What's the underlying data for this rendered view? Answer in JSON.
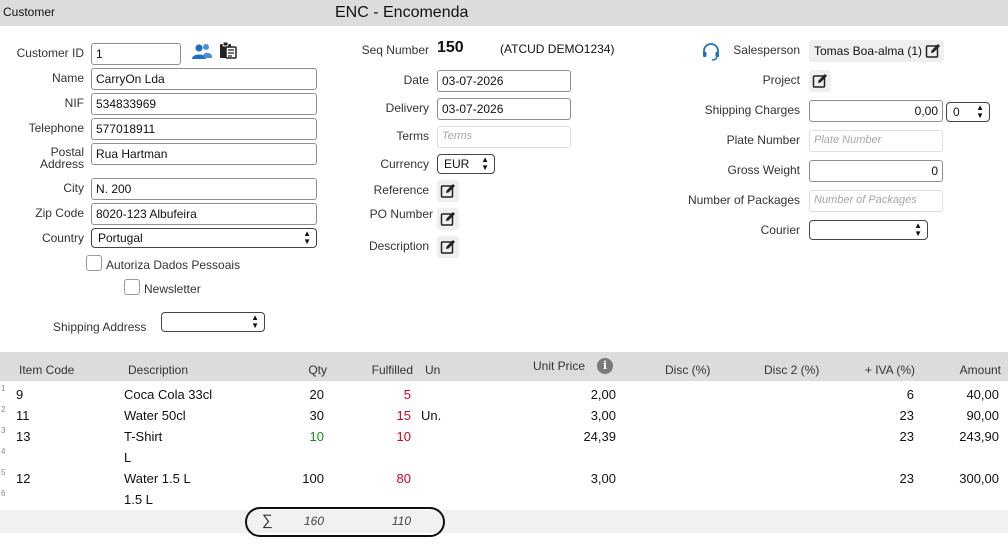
{
  "header": {
    "section_label": "Customer",
    "doc_title": "ENC - Encomenda"
  },
  "customer": {
    "customer_id_label": "Customer ID",
    "customer_id": "1",
    "name_label": "Name",
    "name": "CarryOn Lda",
    "nif_label": "NIF",
    "nif": "534833969",
    "telephone_label": "Telephone",
    "telephone": "577018911",
    "postal_label_1": "Postal",
    "postal_label_2": "Address",
    "postal": "Rua Hartman",
    "city_label": "City",
    "city": "N. 200",
    "zip_label": "Zip Code",
    "zip": "8020-123 Albufeira",
    "country_label": "Country",
    "country": "Portugal",
    "autoriza_label": "Autoriza Dados Pessoais",
    "newsletter_label": "Newsletter",
    "shipping_address_label": "Shipping Address",
    "shipping_address": ""
  },
  "document": {
    "seq_label": "Seq Number",
    "seq": "150",
    "atcud": "(ATCUD DEMO1234)",
    "date_label": "Date",
    "date": "03-07-2026",
    "delivery_label": "Delivery",
    "delivery": "03-07-2026",
    "terms_label": "Terms",
    "terms_placeholder": "Terms",
    "currency_label": "Currency",
    "currency": "EUR",
    "reference_label": "Reference",
    "po_label": "PO Number",
    "description_label": "Description"
  },
  "shipping": {
    "salesperson_label": "Salesperson",
    "salesperson": "Tomas Boa-alma (1)",
    "project_label": "Project",
    "shipping_charges_label": "Shipping Charges",
    "shipping_charges": "0,00",
    "shipping_charges_option": "0",
    "plate_label": "Plate Number",
    "plate_placeholder": "Plate Number",
    "gross_weight_label": "Gross Weight",
    "gross_weight": "0",
    "packages_label": "Number of Packages",
    "packages_placeholder": "Number of Packages",
    "courier_label": "Courier",
    "courier": ""
  },
  "table": {
    "columns": {
      "item_code": "Item Code",
      "description": "Description",
      "qty": "Qty",
      "fulfilled": "Fulfilled",
      "un": "Un",
      "unit_price": "Unit Price",
      "disc": "Disc (%)",
      "disc2": "Disc 2 (%)",
      "iva": "+ IVA (%)",
      "amount": "Amount"
    },
    "rows": [
      {
        "n": "1",
        "code": "9",
        "desc": "Coca Cola 33cl",
        "qty": "20",
        "fulfilled": "5",
        "un": "",
        "price": "2,00",
        "iva": "6",
        "amount": "40,00"
      },
      {
        "n": "2",
        "code": "11",
        "desc": "Water 50cl",
        "qty": "30",
        "fulfilled": "15",
        "un": "Un.",
        "price": "3,00",
        "iva": "23",
        "amount": "90,00"
      },
      {
        "n": "3",
        "code": "13",
        "desc": "T-Shirt",
        "qty": "10",
        "fulfilled": "10",
        "un": "",
        "price": "24,39",
        "iva": "23",
        "amount": "243,90"
      },
      {
        "n": "4",
        "code": "",
        "desc": "L",
        "qty": "",
        "fulfilled": "",
        "un": "",
        "price": "",
        "iva": "",
        "amount": ""
      },
      {
        "n": "5",
        "code": "12",
        "desc": "Water 1.5 L",
        "qty": "100",
        "fulfilled": "80",
        "un": "",
        "price": "3,00",
        "iva": "23",
        "amount": "300,00"
      },
      {
        "n": "6",
        "code": "",
        "desc": "1.5 L",
        "qty": "",
        "fulfilled": "",
        "un": "",
        "price": "",
        "iva": "",
        "amount": ""
      }
    ],
    "totals": {
      "sigma": "∑",
      "qty": "160",
      "fulfilled": "110"
    }
  },
  "colors": {
    "header_bg": "#dcdcdc",
    "accent_blue": "#1e6fc8",
    "fulfilled_red": "#d0021b",
    "fulfilled_green": "#1f8a1f"
  },
  "icons": [
    "contacts-icon",
    "clipboard-icon",
    "headset-icon",
    "edit-icon",
    "info-icon",
    "sigma-icon"
  ]
}
